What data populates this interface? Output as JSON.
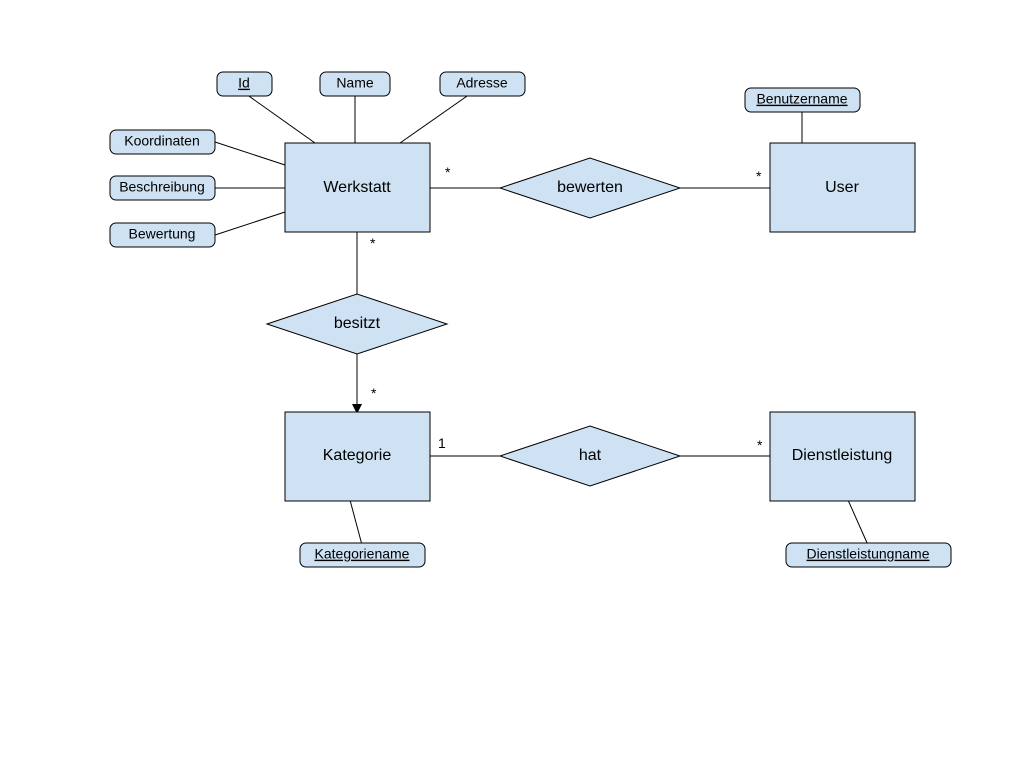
{
  "diagram": {
    "type": "ER",
    "entities": {
      "werkstatt": {
        "label": "Werkstatt"
      },
      "user": {
        "label": "User"
      },
      "kategorie": {
        "label": "Kategorie"
      },
      "dienstleistung": {
        "label": "Dienstleistung"
      }
    },
    "relationships": {
      "bewerten": {
        "label": "bewerten",
        "left_card": "*",
        "right_card": "*"
      },
      "besitzt": {
        "label": "besitzt",
        "top_card": "*",
        "bottom_card": "*"
      },
      "hat": {
        "label": "hat",
        "left_card": "1",
        "right_card": "*"
      }
    },
    "attributes": {
      "id": {
        "label": "Id",
        "key": true,
        "of": "werkstatt"
      },
      "name": {
        "label": "Name",
        "key": false,
        "of": "werkstatt"
      },
      "adresse": {
        "label": "Adresse",
        "key": false,
        "of": "werkstatt"
      },
      "koordinaten": {
        "label": "Koordinaten",
        "key": false,
        "of": "werkstatt"
      },
      "beschreibung": {
        "label": "Beschreibung",
        "key": false,
        "of": "werkstatt"
      },
      "bewertung": {
        "label": "Bewertung",
        "key": false,
        "of": "werkstatt"
      },
      "benutzername": {
        "label": "Benutzername",
        "key": true,
        "of": "user"
      },
      "kategoriename": {
        "label": "Kategoriename",
        "key": true,
        "of": "kategorie"
      },
      "dienstleistungname": {
        "label": "Dienstleistungname",
        "key": true,
        "of": "dienstleistung"
      }
    },
    "colors": {
      "fill": "#cfe2f3",
      "stroke": "#000000"
    }
  }
}
